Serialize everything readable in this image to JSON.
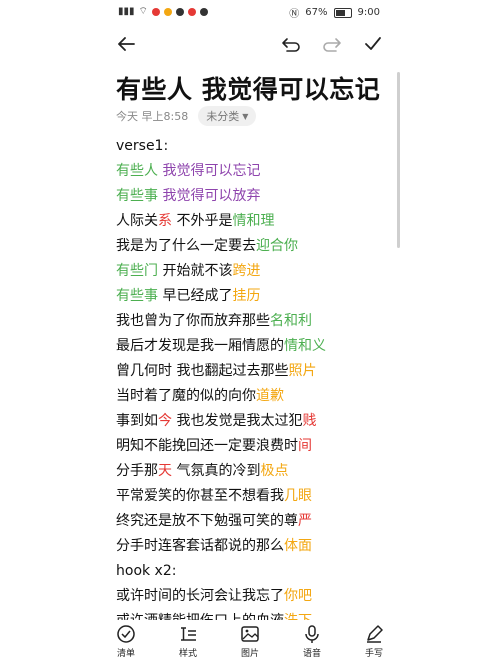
{
  "status": {
    "time": "9:00",
    "battery": "67%"
  },
  "note": {
    "title": "有些人  我觉得可以忘记",
    "date": "今天 早上8:58",
    "category": "未分类"
  },
  "colors": {
    "green": "#4caf50",
    "purple": "#8e44ad",
    "red": "#e53935",
    "orange": "#f3a712",
    "black": "#111111"
  },
  "content": {
    "lines": [
      [
        {
          "text": "verse1:",
          "c": "black"
        }
      ],
      [
        {
          "text": "有些人  ",
          "c": "green"
        },
        {
          "text": "我觉得可以忘记",
          "c": "purple"
        }
      ],
      [
        {
          "text": "有些事  ",
          "c": "green"
        },
        {
          "text": "我觉得可以放弃",
          "c": "purple"
        }
      ],
      [
        {
          "text": "人际关",
          "c": "black"
        },
        {
          "text": "系",
          "c": "red"
        },
        {
          "text": " 不外乎是",
          "c": "black"
        },
        {
          "text": "情和理",
          "c": "green"
        }
      ],
      [
        {
          "text": "我是为了什么一定要去",
          "c": "black"
        },
        {
          "text": "迎合你",
          "c": "green"
        }
      ],
      [
        {
          "text": "有些门",
          "c": "green"
        },
        {
          "text": "  开始就不该",
          "c": "black"
        },
        {
          "text": "跨进",
          "c": "orange"
        }
      ],
      [
        {
          "text": "有些事",
          "c": "green"
        },
        {
          "text": "  早已经成了",
          "c": "black"
        },
        {
          "text": "挂历",
          "c": "orange"
        }
      ],
      [
        {
          "text": "我也曾为了你而放弃那些",
          "c": "black"
        },
        {
          "text": "名和利",
          "c": "green"
        }
      ],
      [
        {
          "text": "最后才发现是我一厢情愿的",
          "c": "black"
        },
        {
          "text": "情和义",
          "c": "green"
        }
      ],
      [
        {
          "text": "曾几何时 我也翻起过去那些",
          "c": "black"
        },
        {
          "text": "照片",
          "c": "orange"
        }
      ],
      [
        {
          "text": "当时着了魔的似的向你",
          "c": "black"
        },
        {
          "text": "道歉",
          "c": "orange"
        }
      ],
      [
        {
          "text": "事到如",
          "c": "black"
        },
        {
          "text": "今",
          "c": "red"
        },
        {
          "text": "  我也发觉是我太过犯",
          "c": "black"
        },
        {
          "text": "贱",
          "c": "red"
        }
      ],
      [
        {
          "text": "明知不能挽回还一定要浪费时",
          "c": "black"
        },
        {
          "text": "间",
          "c": "red"
        }
      ],
      [
        {
          "text": "分手那",
          "c": "black"
        },
        {
          "text": "天",
          "c": "red"
        },
        {
          "text": " 气氛真的冷到",
          "c": "black"
        },
        {
          "text": "极点",
          "c": "orange"
        }
      ],
      [
        {
          "text": "平常爱笑的你甚至不想看我",
          "c": "black"
        },
        {
          "text": "几眼",
          "c": "orange"
        }
      ],
      [
        {
          "text": "终究还是放不下勉强可笑的尊",
          "c": "black"
        },
        {
          "text": "严",
          "c": "red"
        }
      ],
      [
        {
          "text": "分手时连客套话都说的那么",
          "c": "black"
        },
        {
          "text": "体面",
          "c": "orange"
        }
      ],
      [
        {
          "text": "hook x2:",
          "c": "black"
        }
      ],
      [
        {
          "text": "或许时间的长河会让我忘了",
          "c": "black"
        },
        {
          "text": "你吧",
          "c": "orange"
        }
      ],
      [
        {
          "text": "或许酒精能把伤口上的血液",
          "c": "black"
        },
        {
          "text": "洗下",
          "c": "orange"
        }
      ]
    ]
  },
  "bottom_tabs": [
    {
      "label": "清单",
      "icon": "checklist-icon"
    },
    {
      "label": "样式",
      "icon": "text-style-icon"
    },
    {
      "label": "图片",
      "icon": "image-icon"
    },
    {
      "label": "语音",
      "icon": "microphone-icon"
    },
    {
      "label": "手写",
      "icon": "handwriting-icon"
    }
  ]
}
